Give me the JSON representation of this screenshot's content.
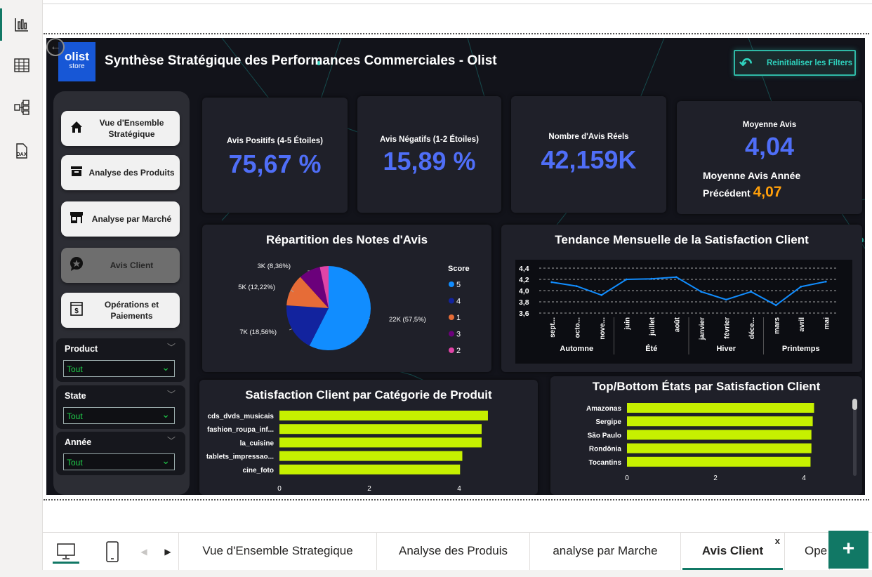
{
  "rail": {
    "items": [
      "report-view",
      "table-view",
      "model-view",
      "dax-query-view"
    ]
  },
  "report": {
    "logo": {
      "line1": "olist",
      "line2": "store"
    },
    "title": "Synthèse Stratégique des Performances Commerciales - Olist",
    "reset_label": "Reinitialiser les Filters",
    "nav": [
      {
        "label": "Vue d'Ensemble Stratégique",
        "icon": "home-icon"
      },
      {
        "label": "Analyse des Produits",
        "icon": "archive-box-icon"
      },
      {
        "label": "Analyse par Marché",
        "icon": "store-icon"
      },
      {
        "label": "Avis Client",
        "icon": "chat-star-icon"
      },
      {
        "label": "Opérations et Paiements",
        "icon": "dollar-bill-icon"
      }
    ],
    "slicers": [
      {
        "label": "Product",
        "value": "Tout"
      },
      {
        "label": "State",
        "value": "Tout"
      },
      {
        "label": "Année",
        "value": "Tout"
      }
    ],
    "kpis": {
      "positive": {
        "label": "Avis Positifs (4-5 Étoiles)",
        "value": "75,67 %"
      },
      "negative": {
        "label": "Avis Négatifs (1-2 Étoiles)",
        "value": "15,89 %"
      },
      "count": {
        "label": "Nombre d'Avis Réels",
        "value": "42,159K"
      },
      "avg": {
        "label": "Moyenne Avis",
        "value": "4,04",
        "prev_label_1": "Moyenne Avis Année",
        "prev_label_2": "Précédent",
        "prev_value": "4,07"
      }
    }
  },
  "chart_data": [
    {
      "type": "pie",
      "title": "Répartition des Notes d'Avis",
      "legend_title": "Score",
      "legend_position": "right",
      "slices": [
        {
          "label": "5",
          "value": 57.5,
          "data_label": "22K (57,5%)",
          "color": "#118dff"
        },
        {
          "label": "4",
          "value": 18.56,
          "data_label": "7K (18,56%)",
          "color": "#12239e"
        },
        {
          "label": "1",
          "value": 12.22,
          "data_label": "5K (12,22%)",
          "color": "#e66c37"
        },
        {
          "label": "3",
          "value": 8.36,
          "data_label": "3K (8,36%)",
          "color": "#6b007b"
        },
        {
          "label": "2",
          "value": 3.36,
          "data_label": "",
          "color": "#e044a7"
        }
      ]
    },
    {
      "type": "line",
      "title": "Tendance Mensuelle de la Satisfaction Client",
      "y_ticks": [
        "4,4",
        "4,2",
        "4,0",
        "3,8",
        "3,6"
      ],
      "ylim": [
        3.6,
        4.4
      ],
      "categories": [
        "sept...",
        "octo...",
        "nove...",
        "juin",
        "juillet",
        "août",
        "janvier",
        "février",
        "déce...",
        "mars",
        "avril",
        "mai"
      ],
      "groups": [
        {
          "label": "Automne",
          "count": 3
        },
        {
          "label": "Été",
          "count": 3
        },
        {
          "label": "Hiver",
          "count": 3
        },
        {
          "label": "Printemps",
          "count": 3
        }
      ],
      "values": [
        4.15,
        4.08,
        3.92,
        4.2,
        4.21,
        4.24,
        3.98,
        3.84,
        3.98,
        3.74,
        4.07,
        4.16
      ],
      "color": "#118dff"
    },
    {
      "type": "bar",
      "orientation": "horizontal",
      "title": "Satisfaction Client par Catégorie de Produit",
      "categories": [
        "cds_dvds_musicais",
        "fashion_roupa_inf...",
        "la_cuisine",
        "tablets_impressao...",
        "cine_foto"
      ],
      "values": [
        4.64,
        4.5,
        4.5,
        4.07,
        4.02
      ],
      "x_ticks": [
        "0",
        "2",
        "4"
      ],
      "xlim": [
        0,
        5
      ],
      "color": "#c6f000"
    },
    {
      "type": "bar",
      "orientation": "horizontal",
      "title": "Top/Bottom États par Satisfaction Client",
      "categories": [
        "Amazonas",
        "Sergipe",
        "São Paulo",
        "Rondônia",
        "Tocantins"
      ],
      "values": [
        4.23,
        4.2,
        4.17,
        4.17,
        4.15
      ],
      "x_ticks": [
        "0",
        "2",
        "4"
      ],
      "xlim": [
        0,
        5
      ],
      "color": "#c6f000"
    }
  ],
  "tabs": [
    {
      "label": "Vue d'Ensemble Strategique",
      "active": false
    },
    {
      "label": "Analyse des Produis",
      "active": false
    },
    {
      "label": "analyse par Marche",
      "active": false
    },
    {
      "label": "Avis Client",
      "active": true
    },
    {
      "label": "Ope",
      "active": false
    }
  ],
  "tab_close": "x",
  "add_page": "+"
}
